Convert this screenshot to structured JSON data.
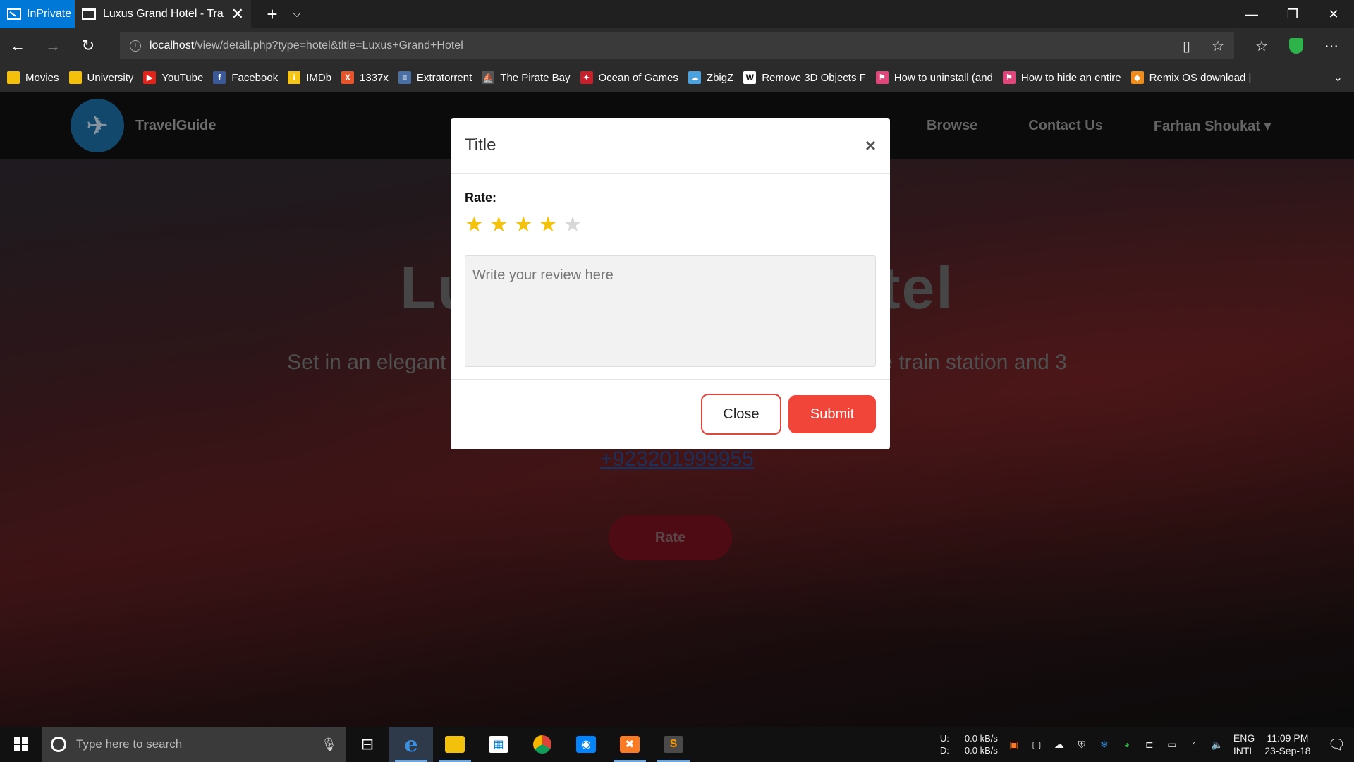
{
  "browser": {
    "inprivate_label": "InPrivate",
    "tab_title": "Luxus Grand Hotel - Tra",
    "url_host": "localhost",
    "url_path": "/view/detail.php?type=hotel&title=Luxus+Grand+Hotel"
  },
  "favorites": [
    {
      "label": "Movies",
      "color": "#f3c10b",
      "icon": "folder-icon"
    },
    {
      "label": "University",
      "color": "#f3c10b",
      "icon": "folder-icon"
    },
    {
      "label": "YouTube",
      "color": "#e62117",
      "icon": "youtube-icon"
    },
    {
      "label": "Facebook",
      "color": "#3b5998",
      "icon": "facebook-icon"
    },
    {
      "label": "IMDb",
      "color": "#f5c518",
      "icon": "imdb-icon"
    },
    {
      "label": "1337x",
      "color": "#e8542a",
      "icon": "x-icon"
    },
    {
      "label": "Extratorrent",
      "color": "#4a6fa5",
      "icon": "page-icon"
    },
    {
      "label": "The Pirate Bay",
      "color": "#555555",
      "icon": "ship-icon"
    },
    {
      "label": "Ocean of Games",
      "color": "#c8202a",
      "icon": "gamepad-icon"
    },
    {
      "label": "ZbigZ",
      "color": "#4aa3df",
      "icon": "cloud-icon"
    },
    {
      "label": "Remove 3D Objects F",
      "color": "#ffffff",
      "icon": "w-icon"
    },
    {
      "label": "How to uninstall (and",
      "color": "#e0457b",
      "icon": "flag-icon"
    },
    {
      "label": "How to hide an entire",
      "color": "#e0457b",
      "icon": "flag-icon"
    },
    {
      "label": "Remix OS download |",
      "color": "#f08c1a",
      "icon": "diamond-icon"
    }
  ],
  "site": {
    "brand": "TravelGuide",
    "nav": [
      "Browse",
      "Contact Us",
      "Farhan Shoukat"
    ],
    "hero_title": "Luxus Grand Hotel",
    "hero_desc": "Set in an elegant building, this upscale hotel is 2 km from Lahore train station and 3 km from the Badshahi Mosque. ...",
    "phone": "+923201999955",
    "rate_button": "Rate"
  },
  "modal": {
    "title": "Title",
    "close_glyph": "×",
    "rate_label": "Rate:",
    "rating": 4,
    "max_rating": 5,
    "review_placeholder": "Write your review here",
    "close_button": "Close",
    "submit_button": "Submit"
  },
  "taskbar": {
    "search_placeholder": "Type here to search",
    "upload_label": "U:",
    "download_label": "D:",
    "upload_speed": "0.0 kB/s",
    "download_speed": "0.0 kB/s",
    "lang_top": "ENG",
    "lang_bottom": "INTL",
    "time": "11:09 PM",
    "date": "23-Sep-18"
  }
}
